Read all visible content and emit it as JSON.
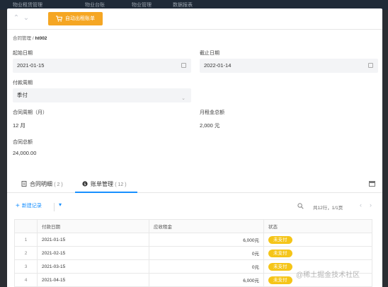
{
  "topnav": {
    "items": [
      "物业租赁管理",
      "物业台账",
      "物业管理",
      "数据报表"
    ]
  },
  "toolbar": {
    "auto_button_label": "自动出租账单"
  },
  "breadcrumb": {
    "parent": "合同管理",
    "separator": "/",
    "current": "ht002"
  },
  "form": {
    "start_date_label": "起始日期",
    "start_date_value": "2021-01-15",
    "end_date_label": "截止日期",
    "end_date_value": "2022-01-14",
    "pay_cycle_label": "付款周期",
    "pay_cycle_value": "季付",
    "contract_period_label": "合同周期（月）",
    "contract_period_value": "12 月",
    "monthly_rent_label": "月租金总额",
    "monthly_rent_value": "2,000 元",
    "contract_total_label": "合同总额",
    "contract_total_value": "24,000.00"
  },
  "tabs": [
    {
      "label": "合同明细",
      "count": "( 2 )",
      "active": false
    },
    {
      "label": "账单管理",
      "count": "( 12 )",
      "active": true
    }
  ],
  "list_toolbar": {
    "new_label": "新建记录",
    "page_info": "共12行，1/1页"
  },
  "table": {
    "columns": [
      "",
      "付款日期",
      "应收租金",
      "状态"
    ],
    "rows": [
      {
        "idx": "1",
        "date": "2021-01-15",
        "rent": "6,000元",
        "status": "未支付"
      },
      {
        "idx": "2",
        "date": "2021-02-15",
        "rent": "0元",
        "status": "未支付"
      },
      {
        "idx": "3",
        "date": "2021-03-15",
        "rent": "0元",
        "status": "未支付"
      },
      {
        "idx": "4",
        "date": "2021-04-15",
        "rent": "6,000元",
        "status": "未支付"
      }
    ]
  },
  "watermark": "@稀土掘金技术社区",
  "colors": {
    "accent": "#1890ff",
    "orange_button": "#f5a623",
    "status_badge": "#f5c518"
  }
}
